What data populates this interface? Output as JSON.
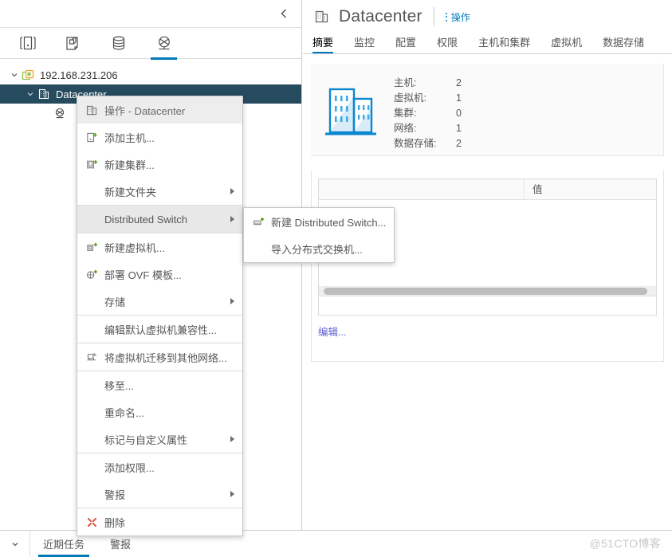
{
  "left_panel": {
    "collapse_icon": "chevron-left-icon",
    "icon_tabs": [
      {
        "name": "hosts-and-clusters",
        "icon": "hosts-clusters-icon",
        "active": false
      },
      {
        "name": "vms-and-templates",
        "icon": "vms-templates-icon",
        "active": false
      },
      {
        "name": "storage",
        "icon": "storage-icon",
        "active": false
      },
      {
        "name": "networking",
        "icon": "networking-icon",
        "active": true
      }
    ],
    "tree": [
      {
        "label": "192.168.231.206",
        "icon": "vcenter-icon",
        "level": 1,
        "expanded": true,
        "selected": false
      },
      {
        "label": "Datacenter",
        "icon": "datacenter-icon",
        "level": 2,
        "expanded": true,
        "selected": true
      },
      {
        "label": "",
        "icon": "network-icon",
        "level": 3,
        "expanded": false,
        "selected": false
      }
    ]
  },
  "context_menu": {
    "header": {
      "label": "操作 - Datacenter",
      "icon": "datacenter-icon"
    },
    "items": [
      {
        "label": "添加主机...",
        "icon": "add-host-icon",
        "submenu": false,
        "highlight": false,
        "sep_after": false
      },
      {
        "label": "新建集群...",
        "icon": "new-cluster-icon",
        "submenu": false,
        "highlight": false,
        "sep_after": false
      },
      {
        "label": "新建文件夹",
        "icon": "",
        "submenu": true,
        "highlight": false,
        "sep_after": true
      },
      {
        "label": "Distributed Switch",
        "icon": "",
        "submenu": true,
        "highlight": true,
        "sep_after": true
      },
      {
        "label": "新建虚拟机...",
        "icon": "new-vm-icon",
        "submenu": false,
        "highlight": false,
        "sep_after": false
      },
      {
        "label": "部署 OVF 模板...",
        "icon": "deploy-ovf-icon",
        "submenu": false,
        "highlight": false,
        "sep_after": false
      },
      {
        "label": "存储",
        "icon": "",
        "submenu": true,
        "highlight": false,
        "sep_after": true
      },
      {
        "label": "编辑默认虚拟机兼容性...",
        "icon": "",
        "submenu": false,
        "highlight": false,
        "sep_after": true
      },
      {
        "label": "将虚拟机迁移到其他网络...",
        "icon": "migrate-vm-icon",
        "submenu": false,
        "highlight": false,
        "sep_after": true
      },
      {
        "label": "移至...",
        "icon": "",
        "submenu": false,
        "highlight": false,
        "sep_after": false
      },
      {
        "label": "重命名...",
        "icon": "",
        "submenu": false,
        "highlight": false,
        "sep_after": false
      },
      {
        "label": "标记与自定义属性",
        "icon": "",
        "submenu": true,
        "highlight": false,
        "sep_after": true
      },
      {
        "label": "添加权限...",
        "icon": "",
        "submenu": false,
        "highlight": false,
        "sep_after": false
      },
      {
        "label": "警报",
        "icon": "",
        "submenu": true,
        "highlight": false,
        "sep_after": true
      },
      {
        "label": "删除",
        "icon": "delete-icon",
        "submenu": false,
        "highlight": false,
        "sep_after": false
      }
    ]
  },
  "submenu": {
    "items": [
      {
        "label": "新建 Distributed Switch...",
        "icon": "new-dvs-icon"
      },
      {
        "label": "导入分布式交换机...",
        "icon": ""
      }
    ]
  },
  "right_panel": {
    "object_icon": "datacenter-icon",
    "object_title": "Datacenter",
    "actions_label": "操作",
    "actions_icon": "kebab-menu-icon",
    "tabs": [
      {
        "label": "摘要",
        "active": true
      },
      {
        "label": "监控",
        "active": false
      },
      {
        "label": "配置",
        "active": false
      },
      {
        "label": "权限",
        "active": false
      },
      {
        "label": "主机和集群",
        "active": false
      },
      {
        "label": "虚拟机",
        "active": false
      },
      {
        "label": "数据存储",
        "active": false
      }
    ],
    "summary": {
      "illustration": "datacenter-building-icon",
      "stats": [
        {
          "label": "主机:",
          "value": "2"
        },
        {
          "label": "虚拟机:",
          "value": "1"
        },
        {
          "label": "集群:",
          "value": "0"
        },
        {
          "label": "网络:",
          "value": "1"
        },
        {
          "label": "数据存储:",
          "value": "2"
        }
      ]
    },
    "attributes_table": {
      "columns": [
        "",
        "值"
      ],
      "rows": [],
      "edit_link": "编辑..."
    }
  },
  "bottom_bar": {
    "caret_icon": "chevron-down-icon",
    "tabs": [
      {
        "label": "近期任务",
        "active": true
      },
      {
        "label": "警报",
        "active": false
      }
    ]
  },
  "watermark": "@51CTO博客",
  "colors": {
    "accent": "#0079b8",
    "selected_row": "#264a5e",
    "link": "#5b5bd6",
    "delete": "#e04e3e",
    "green_plus": "#5aa220"
  }
}
